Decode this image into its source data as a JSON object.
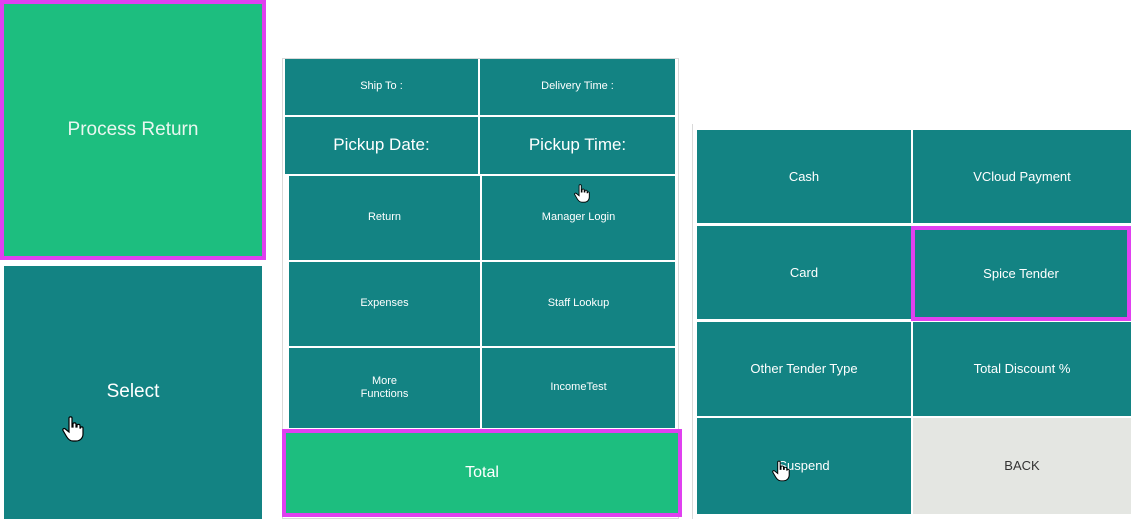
{
  "left_panel": {
    "process_return_label": "Process Return",
    "select_label": "Select"
  },
  "middle_panel": {
    "ship_to_label": "Ship To :",
    "delivery_time_label": "Delivery Time :",
    "pickup_date_label": "Pickup Date:",
    "pickup_time_label": "Pickup Time:",
    "buttons": [
      {
        "label": "Return"
      },
      {
        "label": "Manager Login"
      },
      {
        "label": "Expenses"
      },
      {
        "label": "Staff Lookup"
      },
      {
        "label": "More\nFunctions"
      },
      {
        "label": "IncomeTest"
      }
    ],
    "total_label": "Total"
  },
  "right_panel": {
    "buttons": [
      {
        "label": "Cash"
      },
      {
        "label": "VCloud Payment"
      },
      {
        "label": "Card"
      },
      {
        "label": "Spice Tender"
      },
      {
        "label": "Other Tender Type"
      },
      {
        "label": "Total Discount %"
      },
      {
        "label": "Suspend"
      },
      {
        "label": "BACK"
      }
    ]
  },
  "colors": {
    "teal": "#138383",
    "green": "#1dbe7f",
    "highlight": "#e040f0",
    "back_bg": "#e4e6e2"
  },
  "icons": [
    "hand-pointer-icon"
  ]
}
